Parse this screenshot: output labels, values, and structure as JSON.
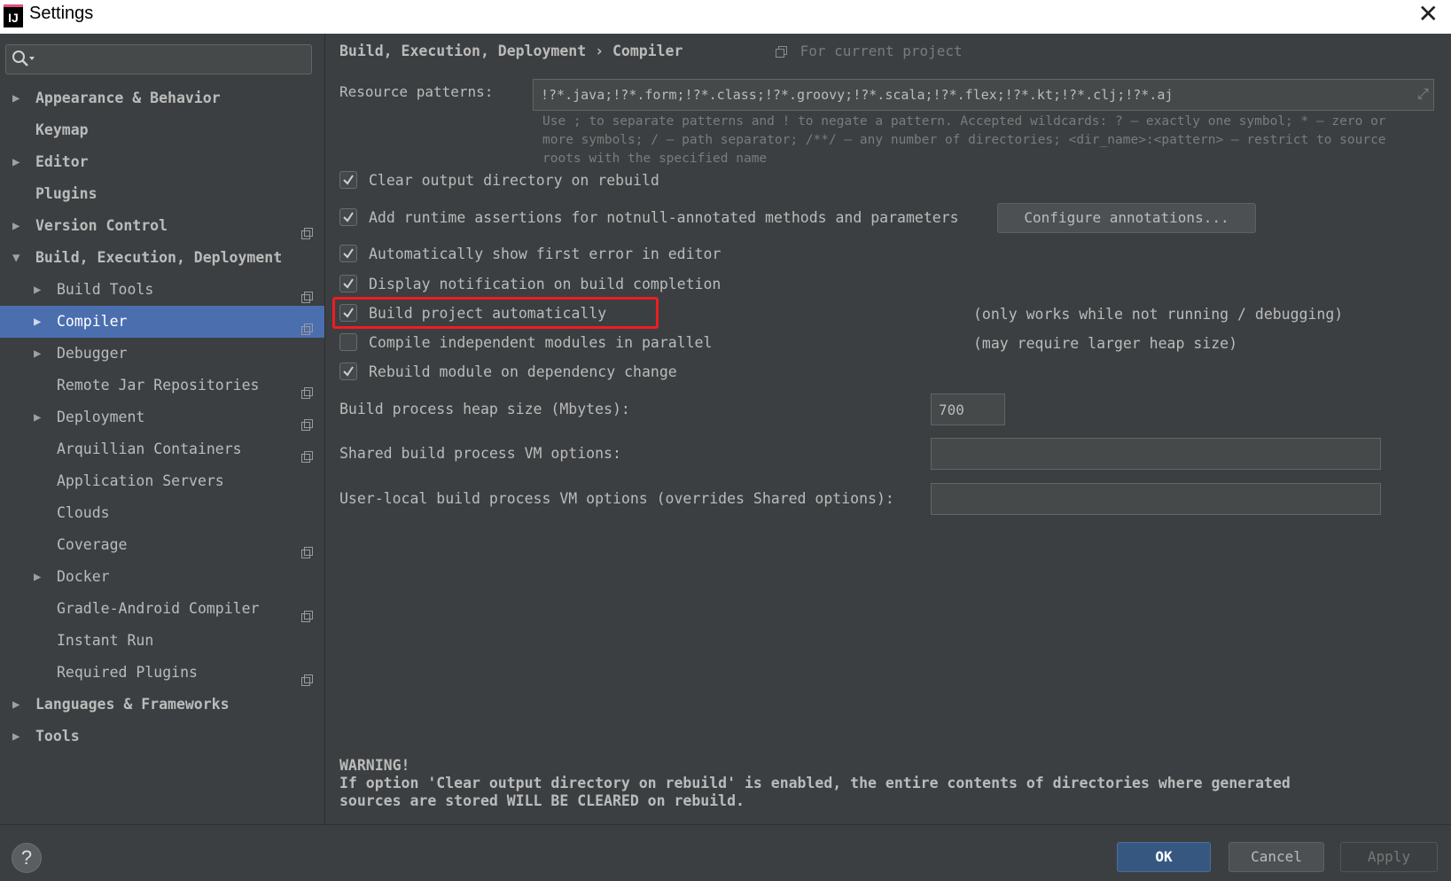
{
  "window": {
    "title": "Settings",
    "app_icon_text": "IJ"
  },
  "search": {
    "placeholder": ""
  },
  "sidebar": {
    "items": [
      {
        "label": "Appearance & Behavior",
        "arrow": "▶",
        "level": 0,
        "bold": true,
        "proj_icon": false,
        "selected": false
      },
      {
        "label": "Keymap",
        "arrow": "",
        "level": 0,
        "bold": true,
        "proj_icon": false,
        "selected": false
      },
      {
        "label": "Editor",
        "arrow": "▶",
        "level": 0,
        "bold": true,
        "proj_icon": false,
        "selected": false
      },
      {
        "label": "Plugins",
        "arrow": "",
        "level": 0,
        "bold": true,
        "proj_icon": false,
        "selected": false
      },
      {
        "label": "Version Control",
        "arrow": "▶",
        "level": 0,
        "bold": true,
        "proj_icon": true,
        "selected": false
      },
      {
        "label": "Build, Execution, Deployment",
        "arrow": "▼",
        "level": 0,
        "bold": true,
        "proj_icon": false,
        "selected": false
      },
      {
        "label": "Build Tools",
        "arrow": "▶",
        "level": 1,
        "bold": false,
        "proj_icon": true,
        "selected": false
      },
      {
        "label": "Compiler",
        "arrow": "▶",
        "level": 1,
        "bold": false,
        "proj_icon": true,
        "selected": true
      },
      {
        "label": "Debugger",
        "arrow": "▶",
        "level": 1,
        "bold": false,
        "proj_icon": false,
        "selected": false
      },
      {
        "label": "Remote Jar Repositories",
        "arrow": "",
        "level": 1,
        "bold": false,
        "proj_icon": true,
        "selected": false
      },
      {
        "label": "Deployment",
        "arrow": "▶",
        "level": 1,
        "bold": false,
        "proj_icon": true,
        "selected": false
      },
      {
        "label": "Arquillian Containers",
        "arrow": "",
        "level": 1,
        "bold": false,
        "proj_icon": true,
        "selected": false
      },
      {
        "label": "Application Servers",
        "arrow": "",
        "level": 1,
        "bold": false,
        "proj_icon": false,
        "selected": false
      },
      {
        "label": "Clouds",
        "arrow": "",
        "level": 1,
        "bold": false,
        "proj_icon": false,
        "selected": false
      },
      {
        "label": "Coverage",
        "arrow": "",
        "level": 1,
        "bold": false,
        "proj_icon": true,
        "selected": false
      },
      {
        "label": "Docker",
        "arrow": "▶",
        "level": 1,
        "bold": false,
        "proj_icon": false,
        "selected": false
      },
      {
        "label": "Gradle-Android Compiler",
        "arrow": "",
        "level": 1,
        "bold": false,
        "proj_icon": true,
        "selected": false
      },
      {
        "label": "Instant Run",
        "arrow": "",
        "level": 1,
        "bold": false,
        "proj_icon": false,
        "selected": false
      },
      {
        "label": "Required Plugins",
        "arrow": "",
        "level": 1,
        "bold": false,
        "proj_icon": true,
        "selected": false
      },
      {
        "label": "Languages & Frameworks",
        "arrow": "▶",
        "level": 0,
        "bold": true,
        "proj_icon": false,
        "selected": false
      },
      {
        "label": "Tools",
        "arrow": "▶",
        "level": 0,
        "bold": true,
        "proj_icon": false,
        "selected": false
      }
    ]
  },
  "main": {
    "breadcrumb": "Build, Execution, Deployment › Compiler",
    "for_current_project": "For current project",
    "resource_patterns_label": "Resource patterns:",
    "resource_patterns_value": "!?*.java;!?*.form;!?*.class;!?*.groovy;!?*.scala;!?*.flex;!?*.kt;!?*.clj;!?*.aj",
    "help_text": "Use ; to separate patterns and ! to negate a pattern. Accepted wildcards: ? — exactly one symbol; * — zero or more symbols; / — path separator; /**/ — any number of directories; <dir_name>:<pattern> — restrict to source roots with the specified name",
    "checkboxes": [
      {
        "label": "Clear output directory on rebuild",
        "checked": true
      },
      {
        "label": "Add runtime assertions for notnull-annotated methods and parameters",
        "checked": true
      },
      {
        "label": "Automatically show first error in editor",
        "checked": true
      },
      {
        "label": "Display notification on build completion",
        "checked": true
      },
      {
        "label": "Build project automatically",
        "checked": true,
        "note": "(only works while not running / debugging)"
      },
      {
        "label": "Compile independent modules in parallel",
        "checked": false,
        "note": "(may require larger heap size)"
      },
      {
        "label": "Rebuild module on dependency change",
        "checked": true
      }
    ],
    "configure_annotations_label": "Configure annotations...",
    "heap_size_label": "Build process heap size (Mbytes):",
    "heap_size_value": "700",
    "shared_vm_label": "Shared build process VM options:",
    "shared_vm_value": "",
    "user_vm_label": "User-local build process VM options (overrides Shared options):",
    "user_vm_value": "",
    "warning_title": "WARNING!",
    "warning_line1": "If option 'Clear output directory on rebuild' is enabled, the entire contents of directories where generated",
    "warning_line2": "sources are stored WILL BE CLEARED on rebuild."
  },
  "footer": {
    "help_label": "?",
    "ok_label": "OK",
    "cancel_label": "Cancel",
    "apply_label": "Apply"
  },
  "colors": {
    "background": "#3c3f41",
    "selection": "#4b6eaf",
    "highlight": "#ee1c24",
    "ok_button": "#365880"
  }
}
